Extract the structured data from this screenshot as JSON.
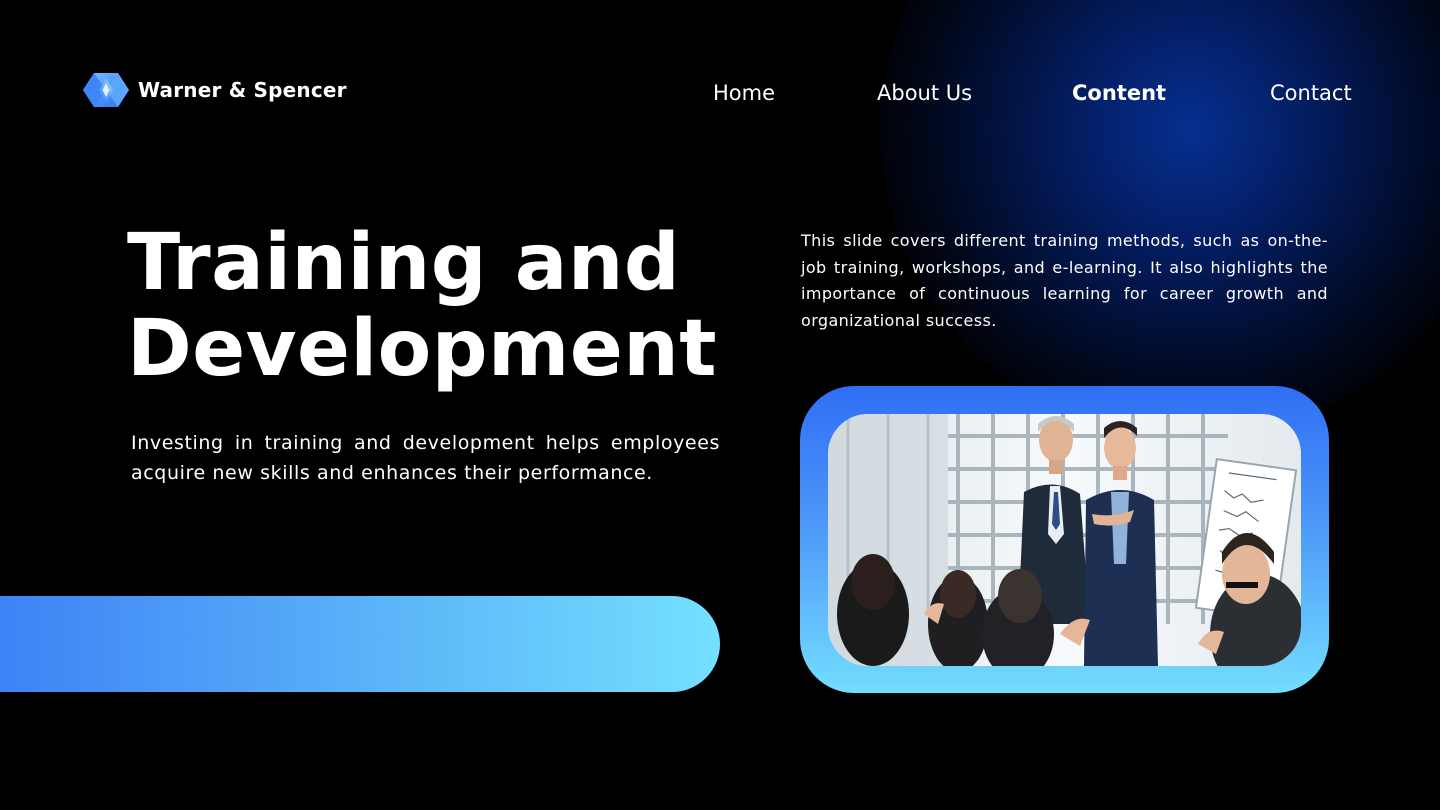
{
  "brand": {
    "name": "Warner & Spencer",
    "logo_icon": "hexagon-diamond-logo-icon"
  },
  "nav": {
    "items": [
      {
        "label": "Home",
        "active": false
      },
      {
        "label": "About Us",
        "active": false
      },
      {
        "label": "Content",
        "active": true
      },
      {
        "label": "Contact",
        "active": false
      }
    ]
  },
  "hero": {
    "title_line1": "Training and",
    "title_line2": "Development",
    "lead": "Investing in training and development helps employees acquire new skills and enhances their performance."
  },
  "summary": {
    "text": "This slide covers different training methods, such as on-the-job training, workshops, and e-learning. It also highlights the importance of continuous learning for career growth and organizational success."
  },
  "photo": {
    "subject": "presenter-with-colleague-photo"
  },
  "colors": {
    "background": "#000000",
    "glow": "#062f8f",
    "accent_start": "#3d83f6",
    "accent_end": "#74e0ff",
    "text": "#ffffff"
  }
}
